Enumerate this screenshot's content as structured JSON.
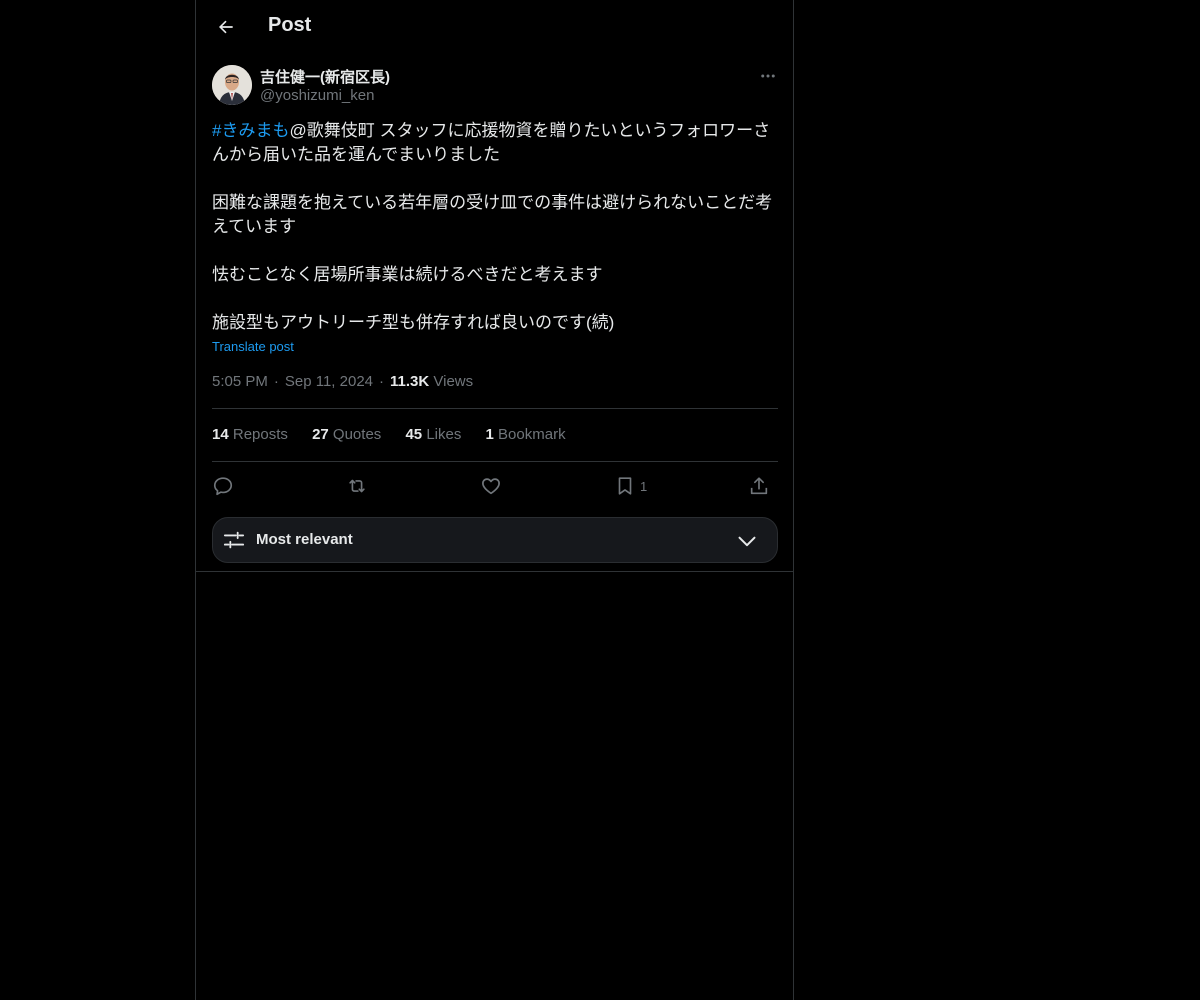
{
  "header": {
    "title": "Post"
  },
  "author": {
    "display_name": "吉住健一(新宿区長)",
    "handle": "@yoshizumi_ken"
  },
  "post": {
    "hashtag": "#きみまも",
    "line1": "@歌舞伎町 スタッフに応援物資を贈りたいというフォロワーさんから届いた品を運んでまいりました",
    "paragraph2": "困難な課題を抱えている若年層の受け皿での事件は避けられないことだ考えています",
    "paragraph3": "怯むことなく居場所事業は続けるべきだと考えます",
    "paragraph4": "施設型もアウトリーチ型も併存すれば良いのです(続)",
    "translate_label": "Translate post",
    "time": "5:05 PM",
    "date": "Sep 11, 2024",
    "views_count": "11.3K",
    "views_label": "Views"
  },
  "stats": {
    "reposts_count": "14",
    "reposts_label": "Reposts",
    "quotes_count": "27",
    "quotes_label": "Quotes",
    "likes_count": "45",
    "likes_label": "Likes",
    "bookmarks_count": "1",
    "bookmarks_label": "Bookmark"
  },
  "actions": {
    "reply_icon": "reply-icon",
    "repost_icon": "repost-icon",
    "like_icon": "heart-icon",
    "bookmark_icon": "bookmark-icon",
    "bookmark_count": "1",
    "share_icon": "share-icon"
  },
  "sort": {
    "label": "Most relevant"
  },
  "colors": {
    "background": "#000000",
    "text_primary": "#e7e9ea",
    "text_secondary": "#71767b",
    "accent": "#1d9bf0",
    "border": "#2f3336"
  }
}
